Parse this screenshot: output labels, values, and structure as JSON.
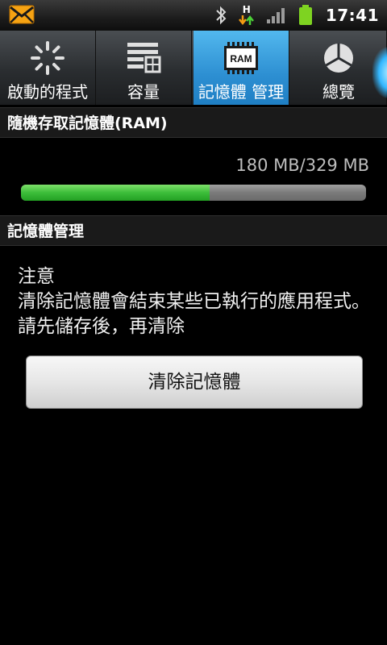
{
  "status_bar": {
    "time": "17:41",
    "network_label": "H",
    "icons": [
      "mail-icon",
      "bluetooth-icon",
      "data-transfer-icon",
      "signal-icon",
      "battery-icon"
    ]
  },
  "tabs": [
    {
      "label": "啟動的程式",
      "icon": "spinner-icon",
      "active": false
    },
    {
      "label": "容量",
      "icon": "storage-icon",
      "active": false
    },
    {
      "label": "記憶體 管理",
      "icon": "ram-icon",
      "icon_text": "RAM",
      "active": true
    },
    {
      "label": "總覽",
      "icon": "pie-chart-icon",
      "active": false
    }
  ],
  "ram_section": {
    "title": "隨機存取記憶體(RAM)",
    "usage_text": "180 MB/329 MB",
    "used_fraction": 0.547
  },
  "memory_section": {
    "title": "記憶體管理",
    "notice_title": "注意",
    "notice_body": "清除記憶體會結束某些已執行的應用程式。請先儲存後，再清除",
    "button_label": "清除記憶體"
  },
  "colors": {
    "accent": "#2d8fd2",
    "progress_used": "#3cbd3a",
    "progress_track": "#7a7a7a"
  }
}
